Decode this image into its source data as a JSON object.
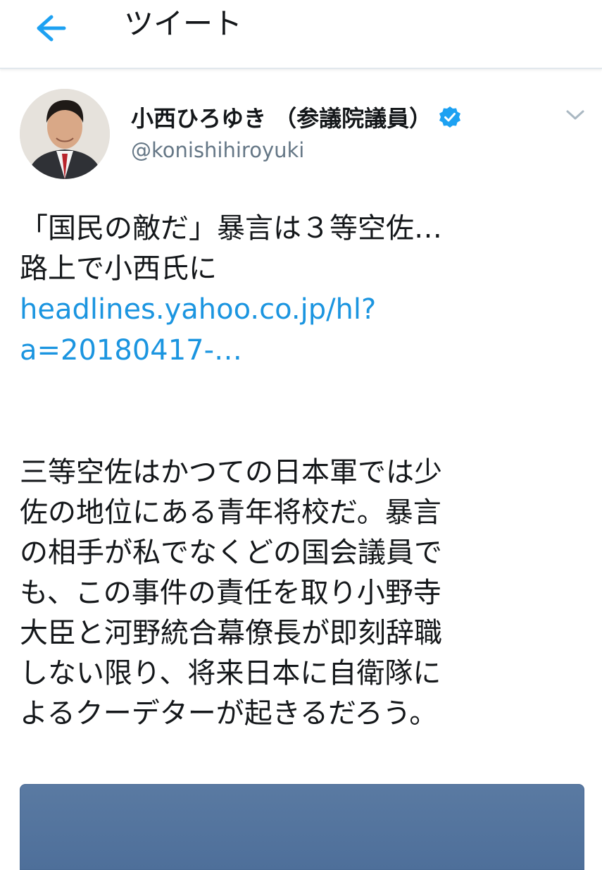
{
  "header": {
    "title": "ツイート",
    "back_icon": "arrow-left-icon"
  },
  "tweet": {
    "author": {
      "display_name": "小西ひろゆき （参議院議員）",
      "handle": "@konishihiroyuki",
      "verified_icon": "verified-badge-icon"
    },
    "menu_icon": "chevron-down-icon",
    "lines": [
      "「国民の敵だ」暴言は３等空佐…",
      "路上で小西氏に"
    ],
    "link_lines": [
      "headlines.yahoo.co.jp/hl?",
      "a=20180417-…"
    ],
    "body_lines": [
      "三等空佐はかつての日本軍では少",
      "佐の地位にある青年将校だ。暴言",
      "の相手が私でなくどの国会議員で",
      "も、この事件の責任を取り小野寺",
      "大臣と河野統合幕僚長が即刻辞職",
      "しない限り、将来日本に自衛隊に",
      "よるクーデターが起きるだろう。"
    ]
  },
  "colors": {
    "link": "#1b95e0",
    "back_arrow": "#1da1f2",
    "verified": "#1da1f2",
    "secondary_text": "#657786"
  }
}
